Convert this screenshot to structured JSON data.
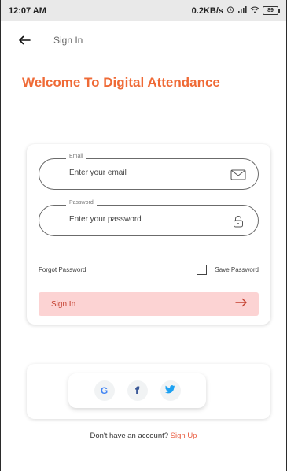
{
  "status_bar": {
    "time": "12:07 AM",
    "network_speed": "0.2KB/s",
    "battery_level": "89"
  },
  "header": {
    "title": "Sign In"
  },
  "welcome_text": "Welcome To Digital Attendance",
  "form": {
    "email": {
      "label": "Email",
      "placeholder": "Enter your email",
      "icon": "mail-icon"
    },
    "password": {
      "label": "Password",
      "placeholder": "Enter your password",
      "icon": "lock-icon"
    },
    "forgot_password": "Forgot Password",
    "save_password": "Save Password",
    "signin_label": "Sign In"
  },
  "social": {
    "google": "G",
    "facebook": "f"
  },
  "signup": {
    "prompt": "Don't have an account?",
    "link": "Sign Up"
  },
  "colors": {
    "accent": "#ef6a36",
    "button_bg": "#fcd3d3",
    "button_text": "#c4402f",
    "google": "#4285f4",
    "facebook": "#3b5998",
    "twitter": "#1da1f2"
  }
}
